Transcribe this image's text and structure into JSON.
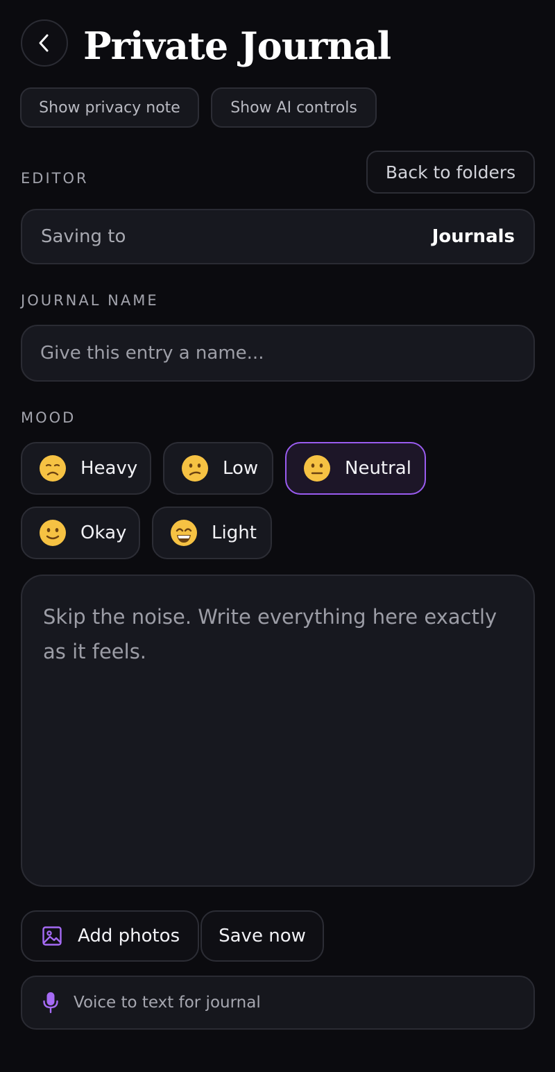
{
  "header": {
    "title": "Private Journal",
    "back_icon": "chevron-left-icon"
  },
  "toggles": {
    "privacy_note_label": "Show privacy note",
    "ai_controls_label": "Show AI controls"
  },
  "editor": {
    "section_label": "EDITOR",
    "back_to_folders_label": "Back to folders",
    "saving_to_label": "Saving to",
    "saving_to_folder": "Journals"
  },
  "journal_name": {
    "section_label": "JOURNAL NAME",
    "value": "",
    "placeholder": "Give this entry a name..."
  },
  "mood": {
    "section_label": "MOOD",
    "selected": "Neutral",
    "options": [
      {
        "label": "Heavy",
        "icon": "sad-face-icon"
      },
      {
        "label": "Low",
        "icon": "confused-face-icon"
      },
      {
        "label": "Neutral",
        "icon": "neutral-face-icon"
      },
      {
        "label": "Okay",
        "icon": "slight-smile-face-icon"
      },
      {
        "label": "Light",
        "icon": "grinning-face-icon"
      }
    ]
  },
  "entry": {
    "value": "",
    "placeholder": "Skip the noise. Write everything here exactly as it feels."
  },
  "actions": {
    "add_photos_label": "Add photos",
    "add_photos_icon": "image-icon",
    "save_now_label": "Save now"
  },
  "voice": {
    "label": "Voice to text for journal",
    "icon": "microphone-icon"
  },
  "colors": {
    "background": "#0b0b0f",
    "surface": "#17181f",
    "border": "#2a2b33",
    "accent": "#9a5cf0",
    "emoji_yellow": "#f6c243"
  }
}
